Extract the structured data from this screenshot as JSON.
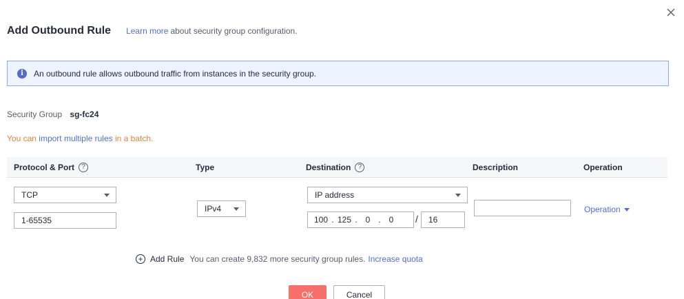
{
  "dialog": {
    "title": "Add Outbound Rule",
    "learn_more": "Learn more",
    "learn_more_rest": "about security group configuration.",
    "close_icon": "close-icon"
  },
  "info": {
    "text": "An outbound rule allows outbound traffic from instances in the security group."
  },
  "security_group": {
    "label": "Security Group",
    "value": "sg-fc24"
  },
  "import": {
    "prefix": "You can",
    "link": "import multiple rules",
    "suffix": "in a batch."
  },
  "table": {
    "headers": {
      "protocol_port": "Protocol & Port",
      "type": "Type",
      "destination": "Destination",
      "description": "Description",
      "operation": "Operation"
    },
    "row": {
      "protocol": "TCP",
      "port": "1-65535",
      "type": "IPv4",
      "destination_mode": "IP address",
      "ip": [
        "100",
        "125",
        "0",
        "0"
      ],
      "mask": "16",
      "description": "",
      "operation": "Operation"
    }
  },
  "add_rule": {
    "label": "Add Rule",
    "quota_text": "You can create 9,832 more security group rules.",
    "quota_link": "Increase quota"
  },
  "footer": {
    "ok": "OK",
    "cancel": "Cancel"
  },
  "colors": {
    "primary_link": "#526ecc",
    "ok_button": "#f66f6a",
    "warning_text": "#e5803b",
    "info_bg": "#edf3ff"
  }
}
